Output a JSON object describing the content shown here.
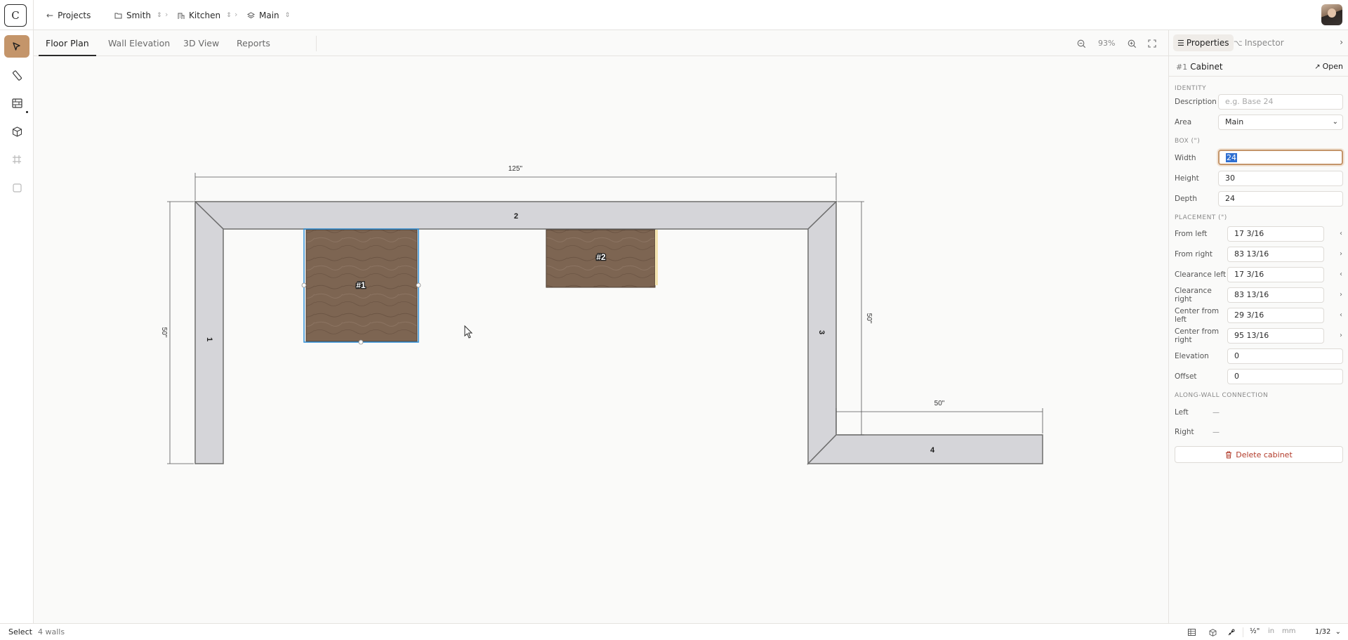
{
  "header": {
    "logo": "C",
    "back_label": "Projects",
    "breadcrumbs": [
      {
        "label": "Smith",
        "icon": "folder-icon"
      },
      {
        "label": "Kitchen",
        "icon": "building-icon"
      },
      {
        "label": "Main",
        "icon": "layers-icon"
      }
    ]
  },
  "tools": [
    {
      "name": "select-tool",
      "icon": "cursor-icon",
      "active": true
    },
    {
      "name": "measure-tool",
      "icon": "ruler-icon"
    },
    {
      "name": "wall-tool",
      "icon": "brick-wall-icon"
    },
    {
      "name": "cabinet-tool",
      "icon": "box-icon"
    },
    {
      "name": "grid-tool",
      "icon": "hash-icon"
    },
    {
      "name": "rectangle-tool",
      "icon": "square-icon"
    }
  ],
  "tabs": [
    "Floor Plan",
    "Wall Elevation",
    "3D View",
    "Reports"
  ],
  "active_tab": "Floor Plan",
  "zoom": "93%",
  "floorplan": {
    "walls": [
      "1",
      "2",
      "3",
      "4"
    ],
    "dimensions": {
      "top": "125\"",
      "left": "50\"",
      "right": "50\"",
      "bottom_right": "50\""
    },
    "cabinets": [
      "#1",
      "#2"
    ],
    "selected_cabinet": "#1"
  },
  "panel": {
    "tabs": [
      "Properties",
      "Inspector"
    ],
    "selection_number": "#1",
    "selection_title": "Cabinet",
    "open_label": "Open",
    "sections": {
      "identity": "IDENTITY",
      "box": "BOX (\")",
      "placement": "PLACEMENT (\")",
      "along_wall": "ALONG-WALL CONNECTION"
    },
    "description_label": "Description",
    "description_placeholder": "e.g. Base 24",
    "area_label": "Area",
    "area_value": "Main",
    "width_label": "Width",
    "width_value": "24",
    "height_label": "Height",
    "height_value": "30",
    "depth_label": "Depth",
    "depth_value": "24",
    "placement": [
      {
        "label": "From left",
        "value": "17 3/16",
        "arrow": "‹"
      },
      {
        "label": "From right",
        "value": "83 13/16",
        "arrow": "›"
      },
      {
        "label": "Clearance left",
        "value": "17 3/16",
        "arrow": "‹"
      },
      {
        "label": "Clearance right",
        "value": "83 13/16",
        "arrow": "›"
      },
      {
        "label": "Center from left",
        "value": "29 3/16",
        "arrow": "‹"
      },
      {
        "label": "Center from right",
        "value": "95 13/16",
        "arrow": "›"
      }
    ],
    "elevation_label": "Elevation",
    "elevation_value": "0",
    "offset_label": "Offset",
    "offset_value": "0",
    "left_label": "Left",
    "left_value": "—",
    "right_label": "Right",
    "right_value": "—",
    "delete_label": "Delete cabinet"
  },
  "status": {
    "mode": "Select",
    "count": "4 walls",
    "units": [
      "½\"",
      "in",
      "mm"
    ],
    "active_unit": "½\"",
    "scale": "1/32"
  }
}
